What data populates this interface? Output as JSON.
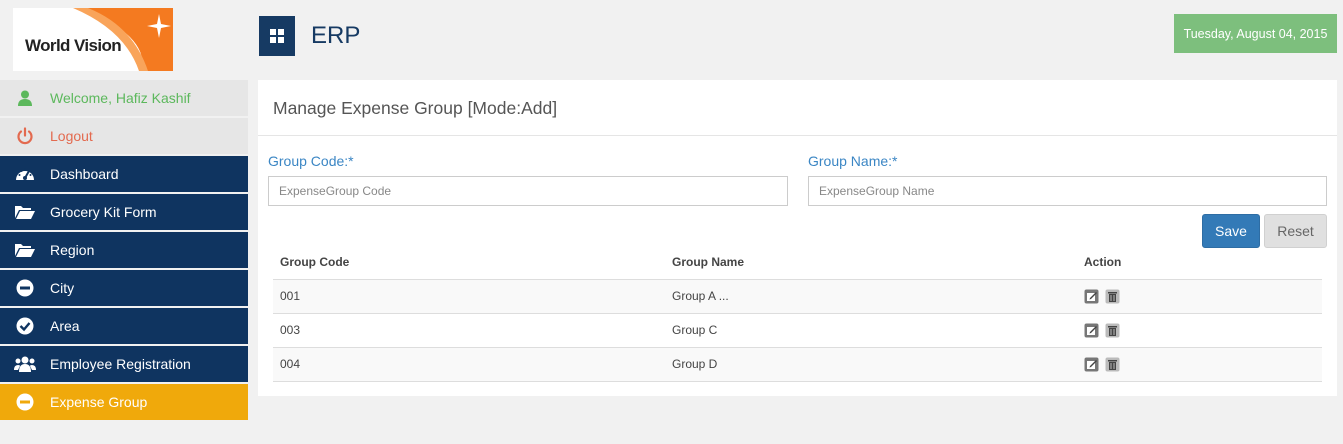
{
  "logo": {
    "text": "World Vision"
  },
  "header": {
    "app_icon": "grid-icon",
    "title": "ERP",
    "date": "Tuesday, August 04, 2015"
  },
  "colors": {
    "navy": "#0f3460",
    "active": "#f0a90b",
    "success": "#5cb85c",
    "danger": "#e36a4f",
    "primary": "#337ab7",
    "date_badge": "#7dbf7d"
  },
  "sidebar": {
    "items": [
      {
        "label": "Welcome, Hafiz Kashif",
        "icon": "user-icon"
      },
      {
        "label": "Logout",
        "icon": "power-icon"
      },
      {
        "label": "Dashboard",
        "icon": "dashboard-icon"
      },
      {
        "label": "Grocery Kit Form",
        "icon": "folder-open-icon"
      },
      {
        "label": "Region",
        "icon": "folder-open-icon"
      },
      {
        "label": "City",
        "icon": "minus-circle-icon"
      },
      {
        "label": "Area",
        "icon": "check-circle-icon"
      },
      {
        "label": "Employee Registration",
        "icon": "users-icon"
      },
      {
        "label": "Expense Group",
        "icon": "minus-circle-icon"
      }
    ]
  },
  "form": {
    "title": "Manage Expense Group [Mode:Add]",
    "group_code_label": "Group Code:*",
    "group_code_value": "",
    "group_code_placeholder": "ExpenseGroup Code",
    "group_name_label": "Group Name:*",
    "group_name_value": "",
    "group_name_placeholder": "ExpenseGroup Name",
    "save_label": "Save",
    "reset_label": "Reset"
  },
  "table": {
    "headers": [
      "Group Code",
      "Group Name",
      "Action"
    ],
    "rows": [
      {
        "code": "001",
        "name": "Group A ..."
      },
      {
        "code": "003",
        "name": "Group C"
      },
      {
        "code": "004",
        "name": "Group D"
      }
    ],
    "action_icons": [
      "edit-icon",
      "delete-icon"
    ]
  }
}
